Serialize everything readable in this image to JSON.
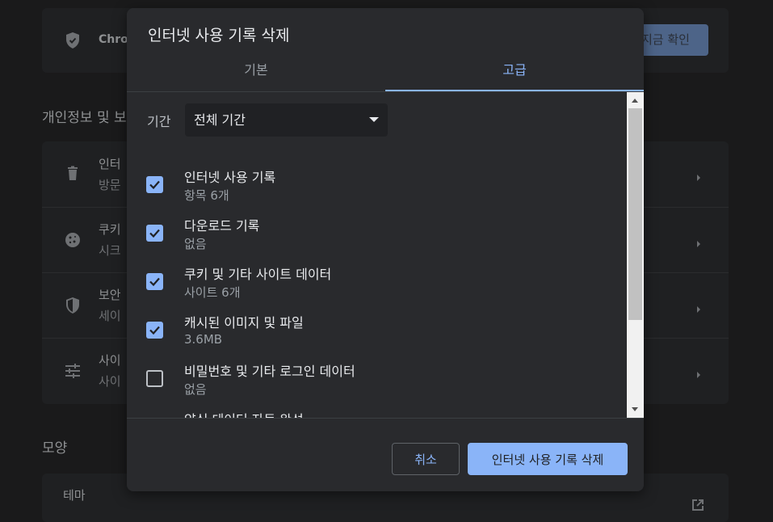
{
  "background": {
    "safety_check_label": "Chro",
    "check_now_button": "지금 확인",
    "privacy_section_title": "개인정보 및 보",
    "privacy_rows": [
      {
        "title": "인터",
        "sub": "방문"
      },
      {
        "title": "쿠키",
        "sub": "시크"
      },
      {
        "title": "보안",
        "sub": "세이"
      },
      {
        "title": "사이",
        "sub": "사이"
      }
    ],
    "appearance_section_title": "모양",
    "theme_row_title": "테마"
  },
  "dialog": {
    "title": "인터넷 사용 기록 삭제",
    "tabs": [
      {
        "label": "기본",
        "selected": false
      },
      {
        "label": "고급",
        "selected": true
      }
    ],
    "time_range": {
      "label": "기간",
      "value": "전체 기간"
    },
    "items": [
      {
        "label": "인터넷 사용 기록",
        "sub": "항목 6개",
        "checked": true
      },
      {
        "label": "다운로드 기록",
        "sub": "없음",
        "checked": true
      },
      {
        "label": "쿠키 및 기타 사이트 데이터",
        "sub": "사이트 6개",
        "checked": true
      },
      {
        "label": "캐시된 이미지 및 파일",
        "sub": "3.6MB",
        "checked": true
      },
      {
        "label": "비밀번호 및 기타 로그인 데이터",
        "sub": "없음",
        "checked": false
      },
      {
        "label": "양식 데이터 자동 완성",
        "sub": "",
        "checked": false
      }
    ],
    "cancel_button": "취소",
    "confirm_button": "인터넷 사용 기록 삭제"
  },
  "colors": {
    "accent": "#8ab4f8",
    "dialog_bg": "#292a2d",
    "page_bg": "#1a1a1b"
  }
}
